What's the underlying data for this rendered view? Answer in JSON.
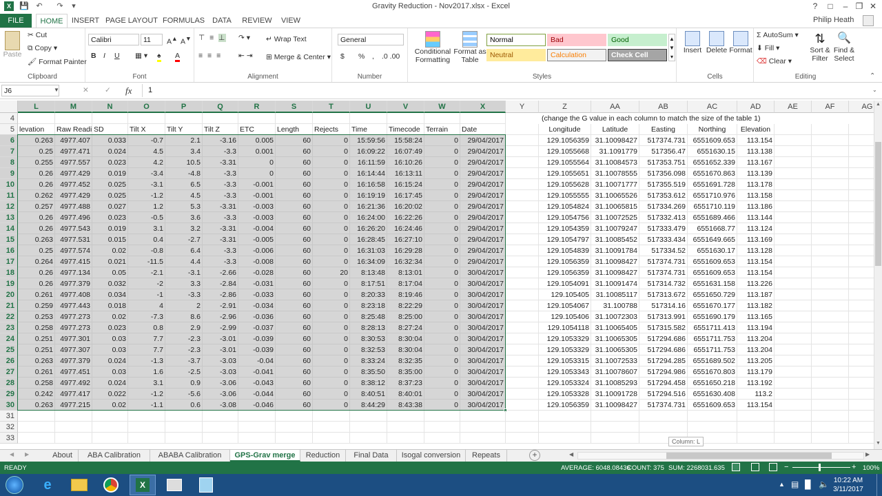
{
  "window": {
    "title": "Gravity Reduction - Nov2017.xlsx - Excel",
    "user": "Philip Heath",
    "help": "?",
    "min": "–",
    "max": "❐",
    "close": "✕"
  },
  "ribbon_tabs": [
    "FILE",
    "HOME",
    "INSERT",
    "PAGE LAYOUT",
    "FORMULAS",
    "DATA",
    "REVIEW",
    "VIEW"
  ],
  "ribbon": {
    "paste": "Paste",
    "cut": "Cut",
    "copy": "Copy",
    "format_painter": "Format Painter",
    "clipboard": "Clipboard",
    "font_name": "Calibri",
    "font_size": "11",
    "bold": "B",
    "italic": "I",
    "underline": "U",
    "font": "Font",
    "wrap_text": "Wrap Text",
    "merge_center": "Merge & Center",
    "alignment": "Alignment",
    "number_format": "General",
    "currency": "$",
    "percent": "%",
    "comma": ",",
    "number": "Number",
    "cond_format": "Conditional Formatting",
    "format_table": "Format as Table",
    "styles_list": [
      {
        "label": "Normal",
        "bg": "#ffffff",
        "fg": "#000000",
        "border": "#7f9f3f"
      },
      {
        "label": "Bad",
        "bg": "#ffc7ce",
        "fg": "#9c0006",
        "border": "#ffc7ce"
      },
      {
        "label": "Good",
        "bg": "#c6efce",
        "fg": "#006100",
        "border": "#c6efce"
      },
      {
        "label": "Neutral",
        "bg": "#ffeb9c",
        "fg": "#9c5700",
        "border": "#ffeb9c"
      },
      {
        "label": "Calculation",
        "bg": "#f2f2f2",
        "fg": "#fa7d00",
        "border": "#7f7f7f"
      },
      {
        "label": "Check Cell",
        "bg": "#a5a5a5",
        "fg": "#ffffff",
        "border": "#3f3f3f"
      }
    ],
    "styles": "Styles",
    "insert": "Insert",
    "delete": "Delete",
    "format": "Format",
    "cells": "Cells",
    "autosum": "AutoSum",
    "fill": "Fill",
    "clear": "Clear",
    "sort_filter": "Sort & Filter",
    "find_select": "Find & Select",
    "editing": "Editing"
  },
  "formula_bar": {
    "name_box": "J6",
    "cancel": "✕",
    "enter": "✓",
    "fx": "fx",
    "value": "1"
  },
  "columns": [
    "L",
    "M",
    "N",
    "O",
    "P",
    "Q",
    "R",
    "S",
    "T",
    "U",
    "V",
    "W",
    "X",
    "Y",
    "Z",
    "AA",
    "AB",
    "AC",
    "AD",
    "AE",
    "AF",
    "AG"
  ],
  "row4_note": "(change the G value in each column to match the size of the table 1)",
  "headers": [
    "levation",
    "Raw Readi",
    "SD",
    "Tilt X",
    "Tilt Y",
    "Tilt Z",
    "ETC",
    "Length",
    "Rejects",
    "Time",
    "Timecode",
    "Terrain",
    "Date",
    "",
    "Longitude",
    "Latitude",
    "Easting",
    "Northing",
    "Elevation",
    "",
    "",
    ""
  ],
  "rows": [
    [
      "0.263",
      "4977.407",
      "0.033",
      "-0.7",
      "2.1",
      "-3.16",
      "0.005",
      "60",
      "0",
      "15:59:56",
      "15:58:24",
      "0",
      "29/04/2017",
      "",
      "129.1056359",
      "31.10098427",
      "517374.731",
      "6551609.653",
      "113.154"
    ],
    [
      "0.25",
      "4977.471",
      "0.024",
      "4.5",
      "3.4",
      "-3.3",
      "0.001",
      "60",
      "0",
      "16:09:22",
      "16:07:49",
      "0",
      "29/04/2017",
      "",
      "129.1055668",
      "31.1091779",
      "517356.47",
      "6551630.15",
      "113.138"
    ],
    [
      "0.255",
      "4977.557",
      "0.023",
      "4.2",
      "10.5",
      "-3.31",
      "0",
      "60",
      "0",
      "16:11:59",
      "16:10:26",
      "0",
      "29/04/2017",
      "",
      "129.1055564",
      "31.10084573",
      "517353.751",
      "6551652.339",
      "113.167"
    ],
    [
      "0.26",
      "4977.429",
      "0.019",
      "-3.4",
      "-4.8",
      "-3.3",
      "0",
      "60",
      "0",
      "16:14:44",
      "16:13:11",
      "0",
      "29/04/2017",
      "",
      "129.1055651",
      "31.10078555",
      "517356.098",
      "6551670.863",
      "113.139"
    ],
    [
      "0.26",
      "4977.452",
      "0.025",
      "-3.1",
      "6.5",
      "-3.3",
      "-0.001",
      "60",
      "0",
      "16:16:58",
      "16:15:24",
      "0",
      "29/04/2017",
      "",
      "129.1055628",
      "31.10071777",
      "517355.519",
      "6551691.728",
      "113.178"
    ],
    [
      "0.262",
      "4977.429",
      "0.025",
      "-1.2",
      "4.5",
      "-3.3",
      "-0.001",
      "60",
      "0",
      "16:19:19",
      "16:17:45",
      "0",
      "29/04/2017",
      "",
      "129.1055555",
      "31.10065526",
      "517353.612",
      "6551710.976",
      "113.158"
    ],
    [
      "0.257",
      "4977.488",
      "0.027",
      "1.2",
      "5.3",
      "-3.31",
      "-0.003",
      "60",
      "0",
      "16:21:36",
      "16:20:02",
      "0",
      "29/04/2017",
      "",
      "129.1054824",
      "31.10065815",
      "517334.269",
      "6551710.119",
      "113.186"
    ],
    [
      "0.26",
      "4977.496",
      "0.023",
      "-0.5",
      "3.6",
      "-3.3",
      "-0.003",
      "60",
      "0",
      "16:24:00",
      "16:22:26",
      "0",
      "29/04/2017",
      "",
      "129.1054756",
      "31.10072525",
      "517332.413",
      "6551689.466",
      "113.144"
    ],
    [
      "0.26",
      "4977.543",
      "0.019",
      "3.1",
      "3.2",
      "-3.31",
      "-0.004",
      "60",
      "0",
      "16:26:20",
      "16:24:46",
      "0",
      "29/04/2017",
      "",
      "129.1054359",
      "31.10079247",
      "517333.479",
      "6551668.77",
      "113.124"
    ],
    [
      "0.263",
      "4977.531",
      "0.015",
      "0.4",
      "-2.7",
      "-3.31",
      "-0.005",
      "60",
      "0",
      "16:28:45",
      "16:27:10",
      "0",
      "29/04/2017",
      "",
      "129.1054797",
      "31.10085452",
      "517333.434",
      "6551649.665",
      "113.169"
    ],
    [
      "0.25",
      "4977.574",
      "0.02",
      "-0.8",
      "6.4",
      "-3.3",
      "-0.006",
      "60",
      "0",
      "16:31:03",
      "16:29:28",
      "0",
      "29/04/2017",
      "",
      "129.1054839",
      "31.10091784",
      "517334.52",
      "6551630.17",
      "113.128"
    ],
    [
      "0.264",
      "4977.415",
      "0.021",
      "-11.5",
      "4.4",
      "-3.3",
      "-0.008",
      "60",
      "0",
      "16:34:09",
      "16:32:34",
      "0",
      "29/04/2017",
      "",
      "129.1056359",
      "31.10098427",
      "517374.731",
      "6551609.653",
      "113.154"
    ],
    [
      "0.26",
      "4977.134",
      "0.05",
      "-2.1",
      "-3.1",
      "-2.66",
      "-0.028",
      "60",
      "20",
      "8:13:48",
      "8:13:01",
      "0",
      "30/04/2017",
      "",
      "129.1056359",
      "31.10098427",
      "517374.731",
      "6551609.653",
      "113.154"
    ],
    [
      "0.26",
      "4977.379",
      "0.032",
      "-2",
      "3.3",
      "-2.84",
      "-0.031",
      "60",
      "0",
      "8:17:51",
      "8:17:04",
      "0",
      "30/04/2017",
      "",
      "129.1054091",
      "31.10091474",
      "517314.732",
      "6551631.158",
      "113.226"
    ],
    [
      "0.261",
      "4977.408",
      "0.034",
      "-1",
      "-3.3",
      "-2.86",
      "-0.033",
      "60",
      "0",
      "8:20:33",
      "8:19:46",
      "0",
      "30/04/2017",
      "",
      "129.105405",
      "31.10085117",
      "517313.672",
      "6551650.729",
      "113.187"
    ],
    [
      "0.259",
      "4977.443",
      "0.018",
      "4",
      "2",
      "-2.91",
      "-0.034",
      "60",
      "0",
      "8:23:18",
      "8:22:29",
      "0",
      "30/04/2017",
      "",
      "129.1054067",
      "31.100788",
      "517314.16",
      "6551670.177",
      "113.182"
    ],
    [
      "0.253",
      "4977.273",
      "0.02",
      "-7.3",
      "8.6",
      "-2.96",
      "-0.036",
      "60",
      "0",
      "8:25:48",
      "8:25:00",
      "0",
      "30/04/2017",
      "",
      "129.105406",
      "31.10072303",
      "517313.991",
      "6551690.179",
      "113.165"
    ],
    [
      "0.258",
      "4977.273",
      "0.023",
      "0.8",
      "2.9",
      "-2.99",
      "-0.037",
      "60",
      "0",
      "8:28:13",
      "8:27:24",
      "0",
      "30/04/2017",
      "",
      "129.1054118",
      "31.10065405",
      "517315.582",
      "6551711.413",
      "113.194"
    ],
    [
      "0.251",
      "4977.301",
      "0.03",
      "7.7",
      "-2.3",
      "-3.01",
      "-0.039",
      "60",
      "0",
      "8:30:53",
      "8:30:04",
      "0",
      "30/04/2017",
      "",
      "129.1053329",
      "31.10065305",
      "517294.686",
      "6551711.753",
      "113.204"
    ],
    [
      "0.251",
      "4977.307",
      "0.03",
      "7.7",
      "-2.3",
      "-3.01",
      "-0.039",
      "60",
      "0",
      "8:32:53",
      "8:30:04",
      "0",
      "30/04/2017",
      "",
      "129.1053329",
      "31.10065305",
      "517294.686",
      "6551711.753",
      "113.204"
    ],
    [
      "0.263",
      "4977.379",
      "0.024",
      "-1.3",
      "-3.7",
      "-3.03",
      "-0.04",
      "60",
      "0",
      "8:33:24",
      "8:32:35",
      "0",
      "30/04/2017",
      "",
      "129.1053315",
      "31.10072533",
      "517294.285",
      "6551689.502",
      "113.205"
    ],
    [
      "0.261",
      "4977.451",
      "0.03",
      "1.6",
      "-2.5",
      "-3.03",
      "-0.041",
      "60",
      "0",
      "8:35:50",
      "8:35:00",
      "0",
      "30/04/2017",
      "",
      "129.1053343",
      "31.10078607",
      "517294.986",
      "6551670.803",
      "113.179"
    ],
    [
      "0.258",
      "4977.492",
      "0.024",
      "3.1",
      "0.9",
      "-3.06",
      "-0.043",
      "60",
      "0",
      "8:38:12",
      "8:37:23",
      "0",
      "30/04/2017",
      "",
      "129.1053324",
      "31.10085293",
      "517294.458",
      "6551650.218",
      "113.192"
    ],
    [
      "0.242",
      "4977.417",
      "0.022",
      "-1.2",
      "-5.6",
      "-3.06",
      "-0.044",
      "60",
      "0",
      "8:40:51",
      "8:40:01",
      "0",
      "30/04/2017",
      "",
      "129.1053328",
      "31.10091728",
      "517294.516",
      "6551630.408",
      "113.2"
    ],
    [
      "0.263",
      "4977.215",
      "0.02",
      "-1.1",
      "0.6",
      "-3.08",
      "-0.046",
      "60",
      "0",
      "8:44:29",
      "8:43:38",
      "0",
      "30/04/2017",
      "",
      "129.1056359",
      "31.10098427",
      "517374.731",
      "6551609.653",
      "113.154"
    ]
  ],
  "tooltip": "Column: L",
  "sheets": [
    "About",
    "ABA Calibration",
    "ABABA Calibration",
    "GPS-Grav merge",
    "Reduction",
    "Final Data",
    "Isogal conversion",
    "Repeats"
  ],
  "active_sheet": "GPS-Grav merge",
  "status": {
    "ready": "READY",
    "average": "AVERAGE: 6048.08436",
    "count": "COUNT: 375",
    "sum": "SUM: 2268031.635",
    "zoom": "100%"
  },
  "taskbar": {
    "time": "10:22 AM",
    "date": "3/11/2017"
  },
  "colors": {
    "accent": "#217346",
    "taskbar": "#1c4e82",
    "selection": "#d6d6d6"
  }
}
